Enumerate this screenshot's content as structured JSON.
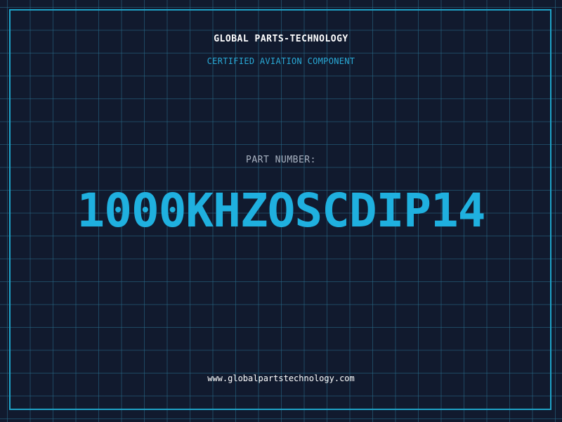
{
  "label": {
    "company": "GLOBAL PARTS-TECHNOLOGY",
    "subtitle": "CERTIFIED AVIATION COMPONENT",
    "part_number_label": "PART NUMBER:",
    "part_number": "1000KHZOSCDIP14",
    "website": "www.globalpartstechnology.com"
  },
  "colors": {
    "background": "#111a2e",
    "grid": "#286e8c",
    "frame": "#1fa3c8",
    "accent": "#1fb0df"
  }
}
